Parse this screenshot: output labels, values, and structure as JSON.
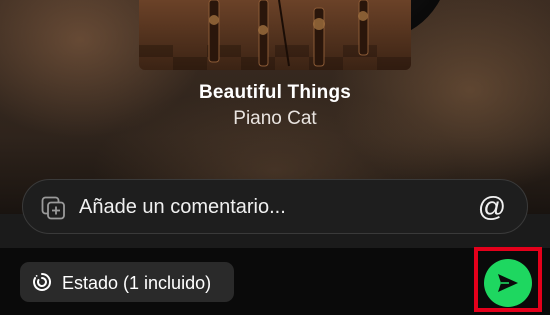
{
  "now_playing": {
    "title": "Beautiful Things",
    "artist": "Piano Cat"
  },
  "comment": {
    "placeholder": "Añade un comentario...",
    "value": "",
    "add_media_icon": "add-media-icon",
    "mention_icon": "at-sign-icon",
    "mention_glyph": "@"
  },
  "status": {
    "label": "Estado (1 incluido)",
    "icon": "status-progress-icon"
  },
  "send": {
    "icon": "send-arrow-icon",
    "color": "#1ed760",
    "highlight_color": "#e4001b"
  }
}
